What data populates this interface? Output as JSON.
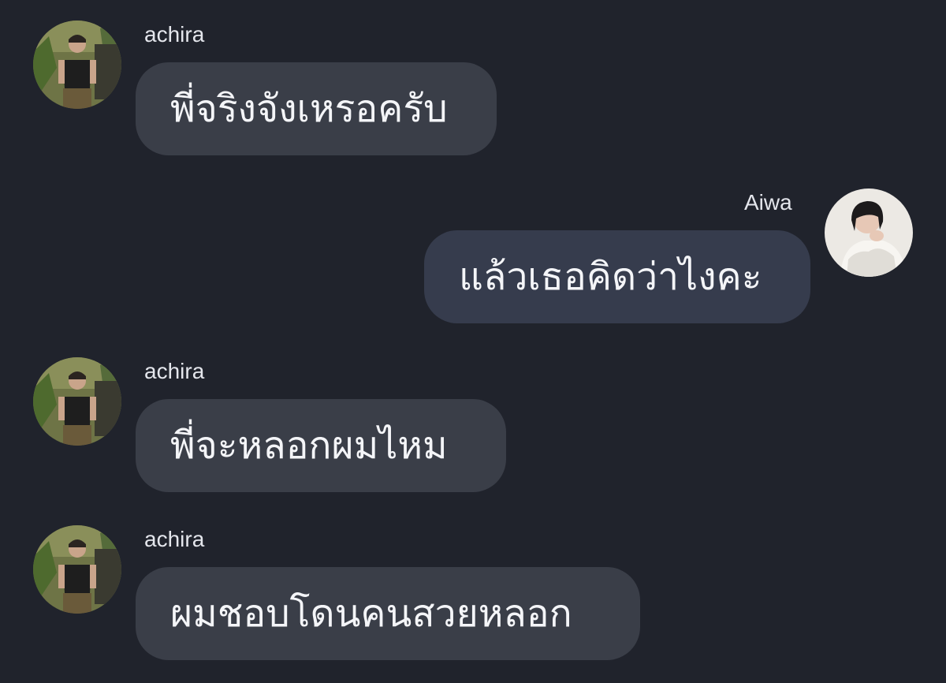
{
  "conversation": {
    "messages": [
      {
        "sender": "achira",
        "text": "พี่จริงจังเหรอครับ",
        "direction": "incoming",
        "avatar": "man-portrait-avatar"
      },
      {
        "sender": "Aiwa",
        "text": "แล้วเธอคิดว่าไงคะ",
        "direction": "outgoing",
        "avatar": "woman-portrait-avatar"
      },
      {
        "sender": "achira",
        "text": "พี่จะหลอกผมไหม",
        "direction": "incoming",
        "avatar": "man-portrait-avatar"
      },
      {
        "sender": "achira",
        "text": "ผมชอบโดนคนสวยหลอก",
        "direction": "incoming",
        "avatar": "man-portrait-avatar"
      }
    ]
  },
  "colors": {
    "background": "#20232c",
    "incoming_bubble": "#3a3e48",
    "outgoing_bubble": "#363c4d",
    "text": "#f4f5f8"
  }
}
